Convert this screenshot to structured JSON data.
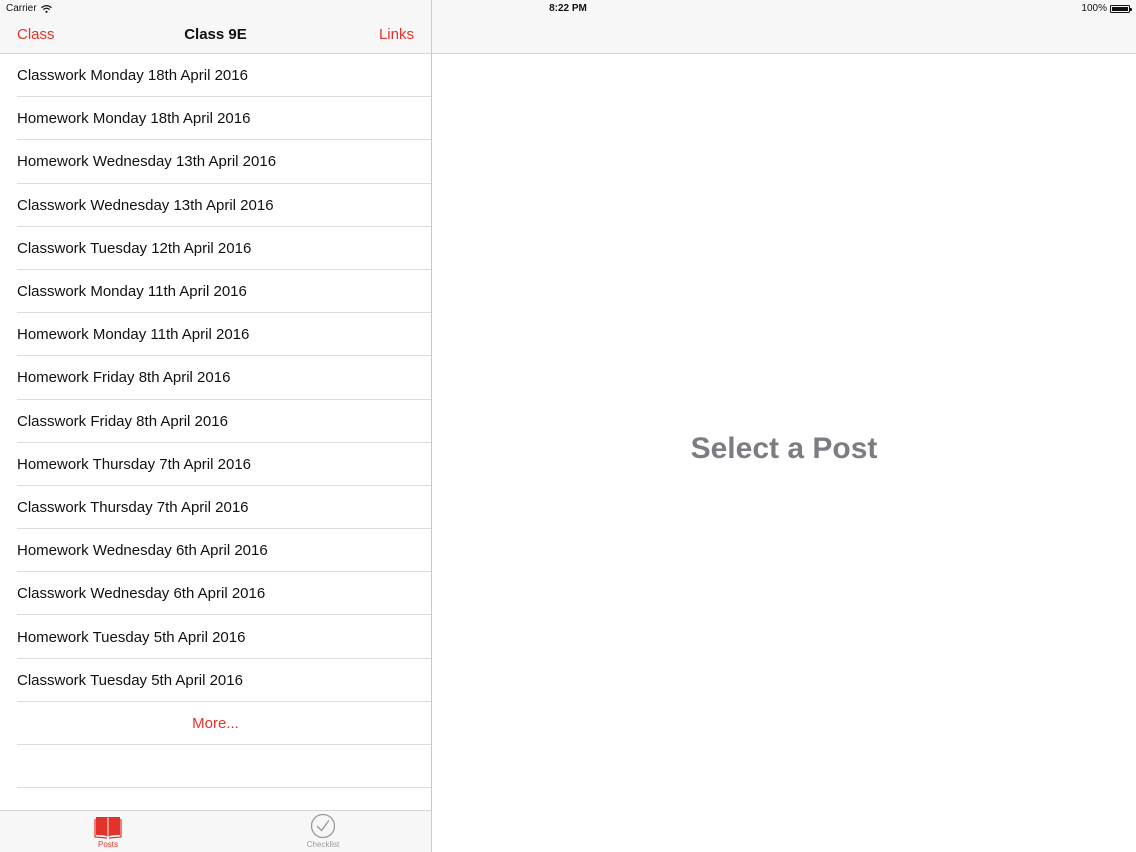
{
  "status_bar": {
    "carrier": "Carrier",
    "time": "8:22 PM",
    "battery": "100%"
  },
  "master": {
    "nav": {
      "left_label": "Class",
      "title": "Class 9E",
      "right_label": "Links"
    },
    "posts": [
      "Classwork Monday 18th April 2016",
      "Homework Monday 18th April 2016",
      "Homework Wednesday 13th April 2016",
      "Classwork Wednesday 13th April 2016",
      "Classwork Tuesday 12th April 2016",
      "Classwork Monday 11th April 2016",
      "Homework Monday 11th April 2016",
      "Homework Friday 8th April 2016",
      "Classwork Friday 8th April 2016",
      "Homework Thursday 7th April 2016",
      "Classwork Thursday 7th April 2016",
      "Homework Wednesday 6th April 2016",
      "Classwork Wednesday 6th April 2016",
      "Homework Tuesday 5th April 2016",
      "Classwork Tuesday 5th April 2016"
    ],
    "more_label": "More..."
  },
  "tabbar": {
    "tabs": [
      {
        "label": "Posts",
        "icon": "book-icon",
        "selected": true
      },
      {
        "label": "Checklist",
        "icon": "checkmark-circle-icon",
        "selected": false
      }
    ]
  },
  "detail": {
    "placeholder": "Select a Post"
  },
  "colors": {
    "accent": "#e2322b",
    "placeholder_text": "#7b7d82",
    "bar_background": "#f7f7f7"
  }
}
